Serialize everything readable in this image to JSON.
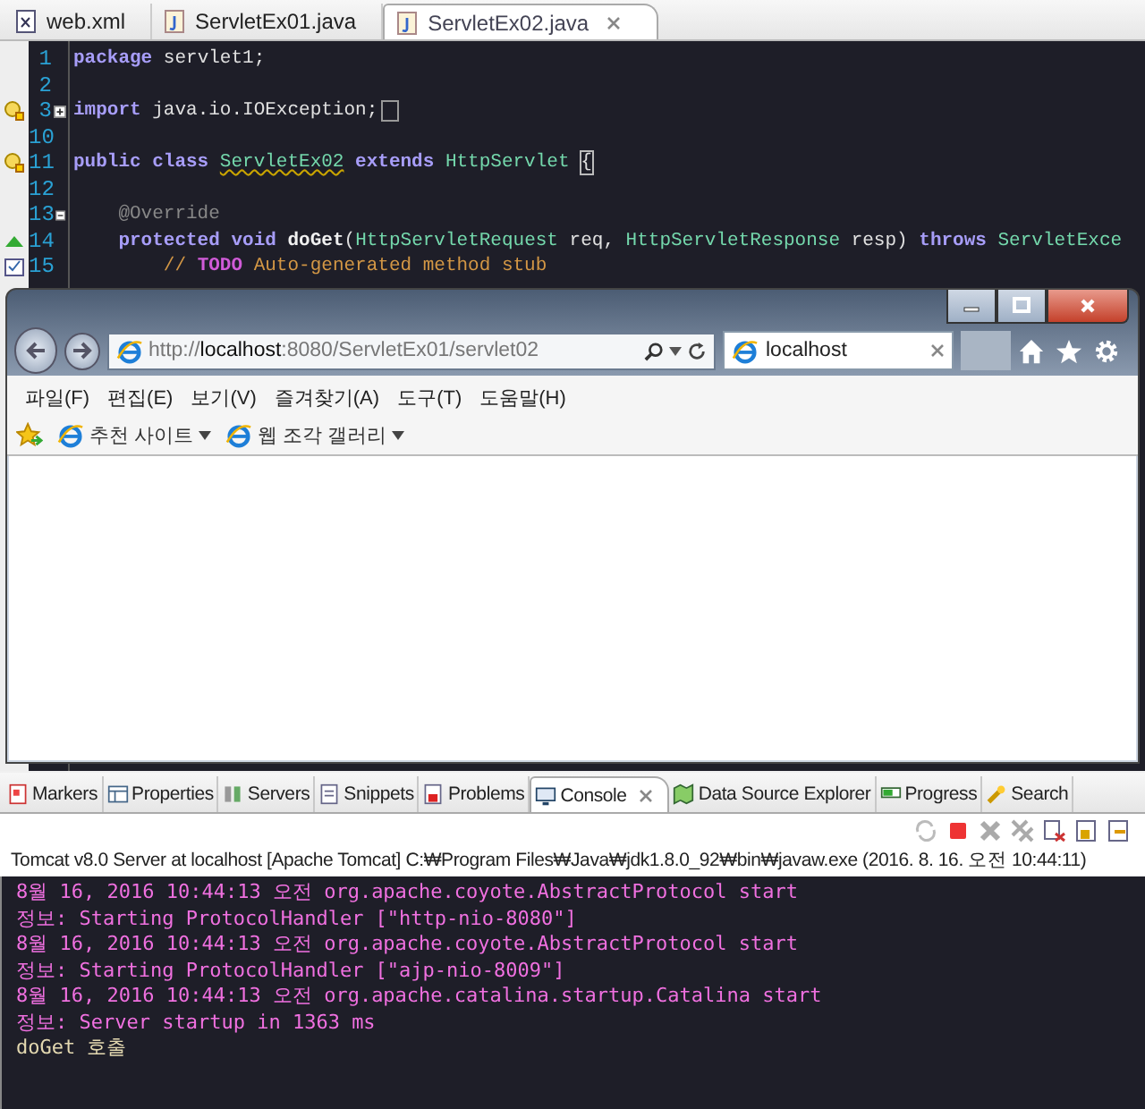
{
  "editor": {
    "tabs": [
      {
        "label": "web.xml",
        "kind": "xml",
        "selected": false
      },
      {
        "label": "ServletEx01.java",
        "kind": "java",
        "selected": false
      },
      {
        "label": "ServletEx02.java",
        "kind": "java",
        "selected": true
      }
    ],
    "lines": [
      {
        "number": "1",
        "tokens": [
          {
            "t": "package ",
            "kind": "keyword"
          },
          {
            "t": "servlet1;",
            "kind": "plain"
          }
        ]
      },
      {
        "number": "2"
      },
      {
        "number": "3",
        "warning": true,
        "collapsed": true,
        "folded": true,
        "tokens": [
          {
            "t": "import ",
            "kind": "keyword"
          },
          {
            "t": "java.io.IOException;",
            "kind": "plain"
          }
        ]
      },
      {
        "number": "10"
      },
      {
        "number": "11",
        "warning": true,
        "tokens": [
          {
            "t": "public class ",
            "kind": "keyword"
          },
          {
            "t": "ServletEx02",
            "kind": "flagged"
          },
          {
            "t": " extends ",
            "kind": "keyword"
          },
          {
            "t": "HttpServlet ",
            "kind": "type"
          },
          {
            "t": "{",
            "kind": "matched"
          }
        ]
      },
      {
        "number": "12"
      },
      {
        "number": "13",
        "collapsed": false,
        "tokens": [
          {
            "t": "    @Override",
            "kind": "annotation"
          }
        ]
      },
      {
        "number": "14",
        "override": true,
        "tokens": [
          {
            "t": "    protected void ",
            "kind": "keyword"
          },
          {
            "t": "doGet",
            "kind": "method"
          },
          {
            "t": "(",
            "kind": "plain"
          },
          {
            "t": "HttpServletRequest",
            "kind": "type"
          },
          {
            "t": " req, ",
            "kind": "plain"
          },
          {
            "t": "HttpServletResponse",
            "kind": "type"
          },
          {
            "t": " resp) ",
            "kind": "plain"
          },
          {
            "t": "throws ",
            "kind": "keyword"
          },
          {
            "t": "ServletExce",
            "kind": "type"
          }
        ]
      },
      {
        "number": "15",
        "task": true,
        "tokens": [
          {
            "t": "        // ",
            "kind": "comment"
          },
          {
            "t": "TODO",
            "kind": "todo"
          },
          {
            "t": " Auto-generated method stub",
            "kind": "comment"
          }
        ]
      }
    ]
  },
  "browser": {
    "address": "http://**localhost**:8080/ServletEx01/servlet02",
    "tabs": [
      {
        "label": "localhost",
        "selected": true
      }
    ],
    "menu": [
      "파일(F)",
      "편집(E)",
      "보기(V)",
      "즐겨찾기(A)",
      "도구(T)",
      "도움말(H)"
    ],
    "favorites": [
      {
        "label": "추천 사이트",
        "dropdown": true
      },
      {
        "label": "웹 조각 갤러리",
        "dropdown": true
      }
    ]
  },
  "views": {
    "tabs": [
      {
        "label": "Markers",
        "kind": "markers",
        "selected": false
      },
      {
        "label": "Properties",
        "kind": "properties",
        "selected": false
      },
      {
        "label": "Servers",
        "kind": "servers",
        "selected": false
      },
      {
        "label": "Snippets",
        "kind": "snippets",
        "selected": false
      },
      {
        "label": "Problems",
        "kind": "problems",
        "selected": false
      },
      {
        "label": "Console",
        "kind": "console",
        "selected": true
      },
      {
        "label": "Data Source Explorer",
        "kind": "datasource",
        "selected": false
      },
      {
        "label": "Progress",
        "kind": "progress",
        "selected": false
      },
      {
        "label": "Search",
        "kind": "search",
        "selected": false
      }
    ],
    "console_title": "Tomcat v8.0 Server at localhost [Apache Tomcat] C:₩Program Files₩Java₩jdk1.8.0_92₩bin₩javaw.exe (2016. 8. 16. 오전 10:44:11)",
    "console_lines": [
      {
        "text": "8월 16, 2016 10:44:13 오전 org.apache.coyote.AbstractProtocol start",
        "kind": "stderr"
      },
      {
        "text": "정보: Starting ProtocolHandler [\"http-nio-8080\"]",
        "kind": "stderr"
      },
      {
        "text": "8월 16, 2016 10:44:13 오전 org.apache.coyote.AbstractProtocol start",
        "kind": "stderr"
      },
      {
        "text": "정보: Starting ProtocolHandler [\"ajp-nio-8009\"]",
        "kind": "stderr"
      },
      {
        "text": "8월 16, 2016 10:44:13 오전 org.apache.catalina.startup.Catalina start",
        "kind": "stderr"
      },
      {
        "text": "정보: Server startup in 1363 ms",
        "kind": "stderr"
      },
      {
        "text": "doGet 호출",
        "kind": "stdout"
      }
    ]
  }
}
